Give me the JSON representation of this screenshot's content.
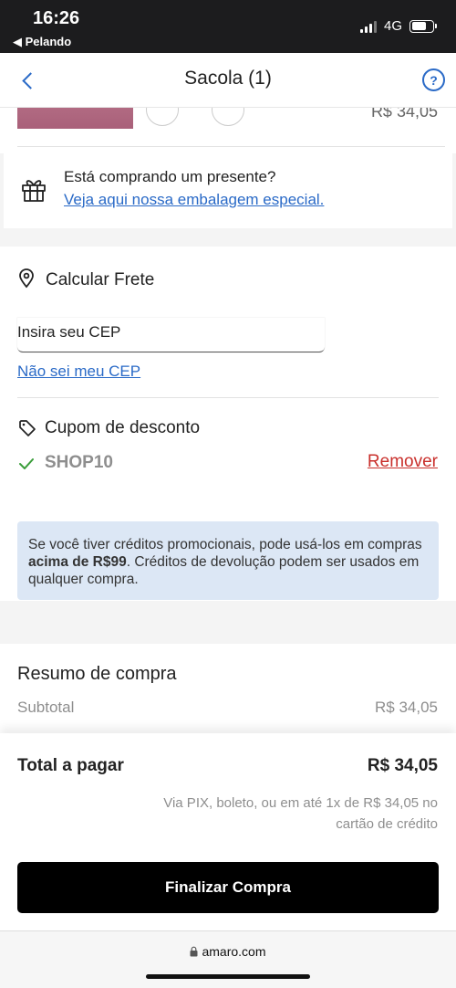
{
  "status_bar": {
    "time": "16:26",
    "back_app": "◀ Pelando",
    "network": "4G"
  },
  "header": {
    "title": "Sacola (1)",
    "help_label": "?"
  },
  "product": {
    "price": "R$ 34,05"
  },
  "gift": {
    "title": "Está comprando um presente?",
    "link": "Veja aqui nossa embalagem especial."
  },
  "freight": {
    "title": "Calcular Frete",
    "cep_placeholder": "Insira seu CEP",
    "cep_value": "",
    "cep_help_link": "Não sei meu CEP"
  },
  "coupon": {
    "title": "Cupom de desconto",
    "code": "SHOP10",
    "remove_label": "Remover"
  },
  "info": {
    "text_before": "Se você tiver créditos promocionais, pode usá-los em compras ",
    "text_bold": "acima de R$99",
    "text_after": ". Créditos de devolução podem ser usados em qualquer compra."
  },
  "summary": {
    "title": "Resumo de compra",
    "subtotal_label": "Subtotal",
    "subtotal_value": "R$ 34,05"
  },
  "total": {
    "label": "Total a pagar",
    "value": "R$ 34,05",
    "payment_note": "Via PIX, boleto, ou em até 1x de R$ 34,05 no cartão de crédito",
    "checkout_label": "Finalizar Compra"
  },
  "browser": {
    "domain": "amaro.com"
  },
  "colors": {
    "link": "#2a6ac7",
    "danger": "#c9302c",
    "success": "#3a9d3a",
    "info_bg": "#dce7f5",
    "button_bg": "#000000"
  },
  "icons": [
    "chevron-left-icon",
    "help-icon",
    "gift-icon",
    "map-pin-icon",
    "tag-icon",
    "check-icon",
    "lock-icon"
  ]
}
